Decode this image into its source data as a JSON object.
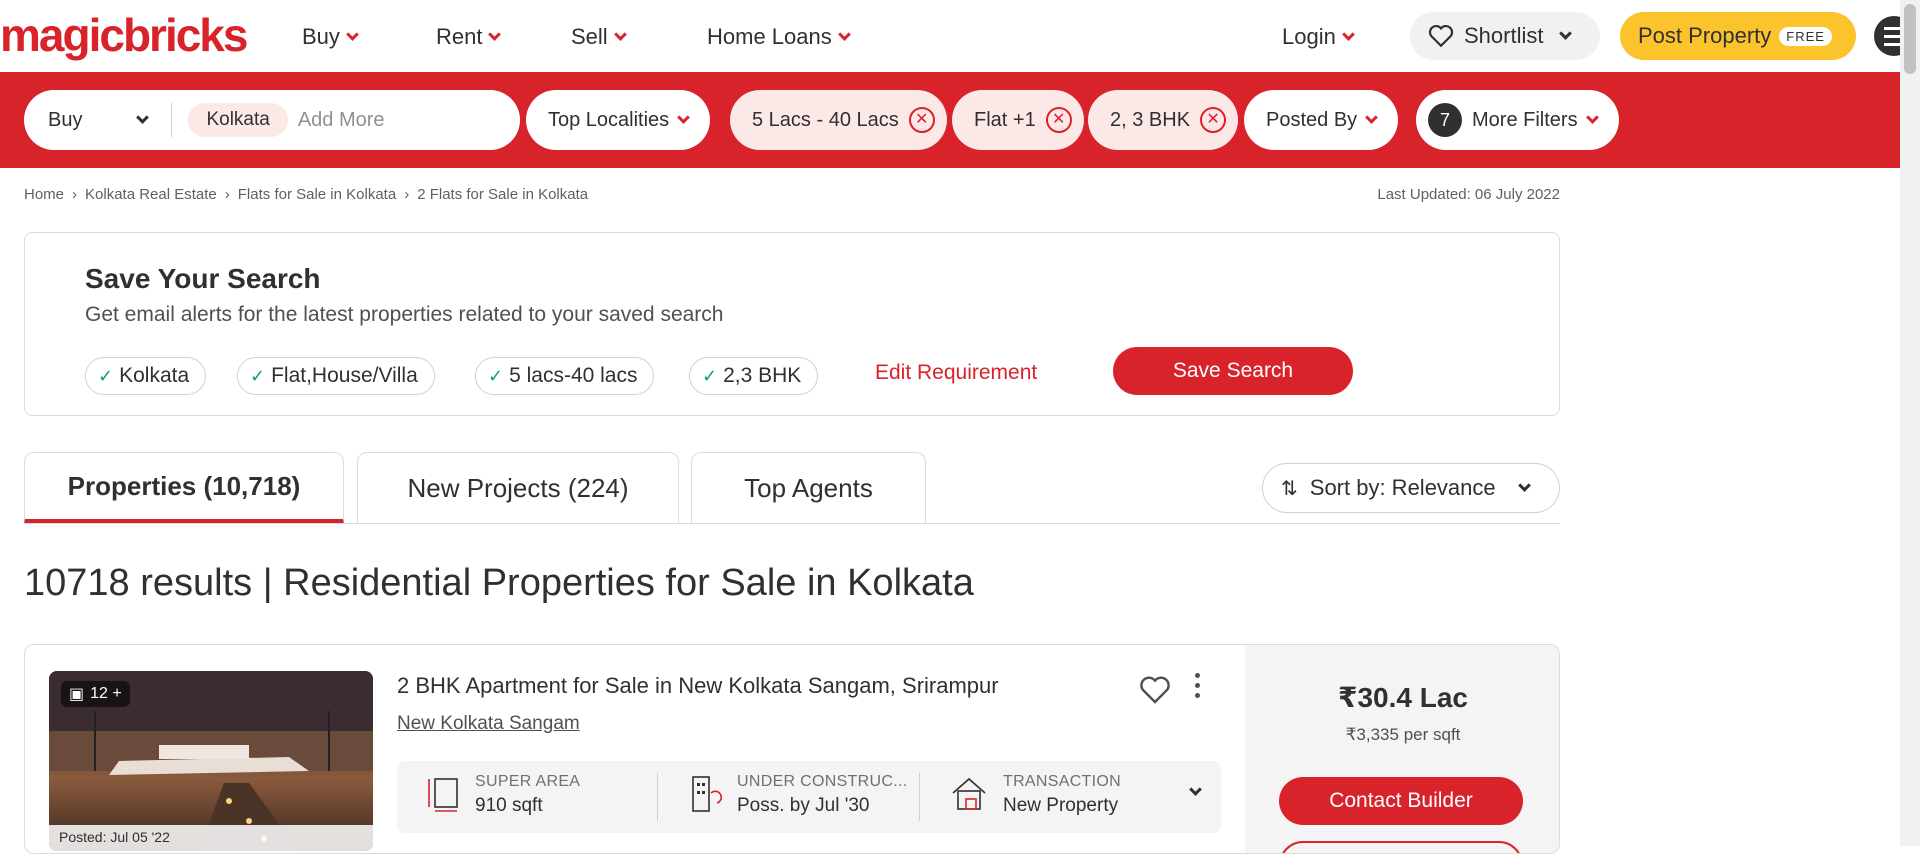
{
  "header": {
    "logo": "magicbricks",
    "nav": [
      "Buy",
      "Rent",
      "Sell",
      "Home Loans"
    ],
    "login": "Login",
    "shortlist": "Shortlist",
    "post_property": "Post Property",
    "free_badge": "FREE"
  },
  "filters": {
    "buy": "Buy",
    "city_chip": "Kolkata",
    "add_more": "Add More",
    "top_localities": "Top Localities",
    "budget": "5 Lacs - 40 Lacs",
    "property_type": "Flat +1",
    "bhk": "2, 3 BHK",
    "posted_by": "Posted By",
    "more_filters_count": "7",
    "more_filters": "More Filters"
  },
  "breadcrumb": [
    "Home",
    "Kolkata Real Estate",
    "Flats for Sale in Kolkata",
    "2 Flats for Sale in Kolkata"
  ],
  "last_updated": "Last Updated: 06 July 2022",
  "save_search": {
    "title": "Save Your Search",
    "subtitle": "Get email alerts for the latest properties related to your saved search",
    "chips": [
      "Kolkata",
      "Flat,House/Villa",
      "5 lacs-40 lacs",
      "2,3 BHK"
    ],
    "edit_requirement": "Edit Requirement",
    "save_button": "Save Search"
  },
  "tabs": [
    "Properties (10,718)",
    "New Projects (224)",
    "Top Agents"
  ],
  "sort": "Sort by: Relevance",
  "results_heading": "10718 results | Residential Properties for Sale in Kolkata",
  "listing": {
    "image_count": "12 +",
    "posted": "Posted: Jul 05 '22",
    "title": "2 BHK Apartment for Sale in New Kolkata Sangam, Srirampur",
    "project": "New Kolkata Sangam",
    "specs": [
      {
        "label": "SUPER AREA",
        "value": "910 sqft"
      },
      {
        "label": "UNDER CONSTRUC...",
        "value": "Poss. by Jul '30"
      },
      {
        "label": "TRANSACTION",
        "value": "New Property"
      }
    ],
    "price": "₹30.4 Lac",
    "price_per_sqft": "₹3,335 per sqft",
    "contact_button": "Contact Builder"
  },
  "colors": {
    "brand_red": "#d8232a",
    "post_yellow": "#fbc32c",
    "check_green": "#0d9b7a"
  }
}
